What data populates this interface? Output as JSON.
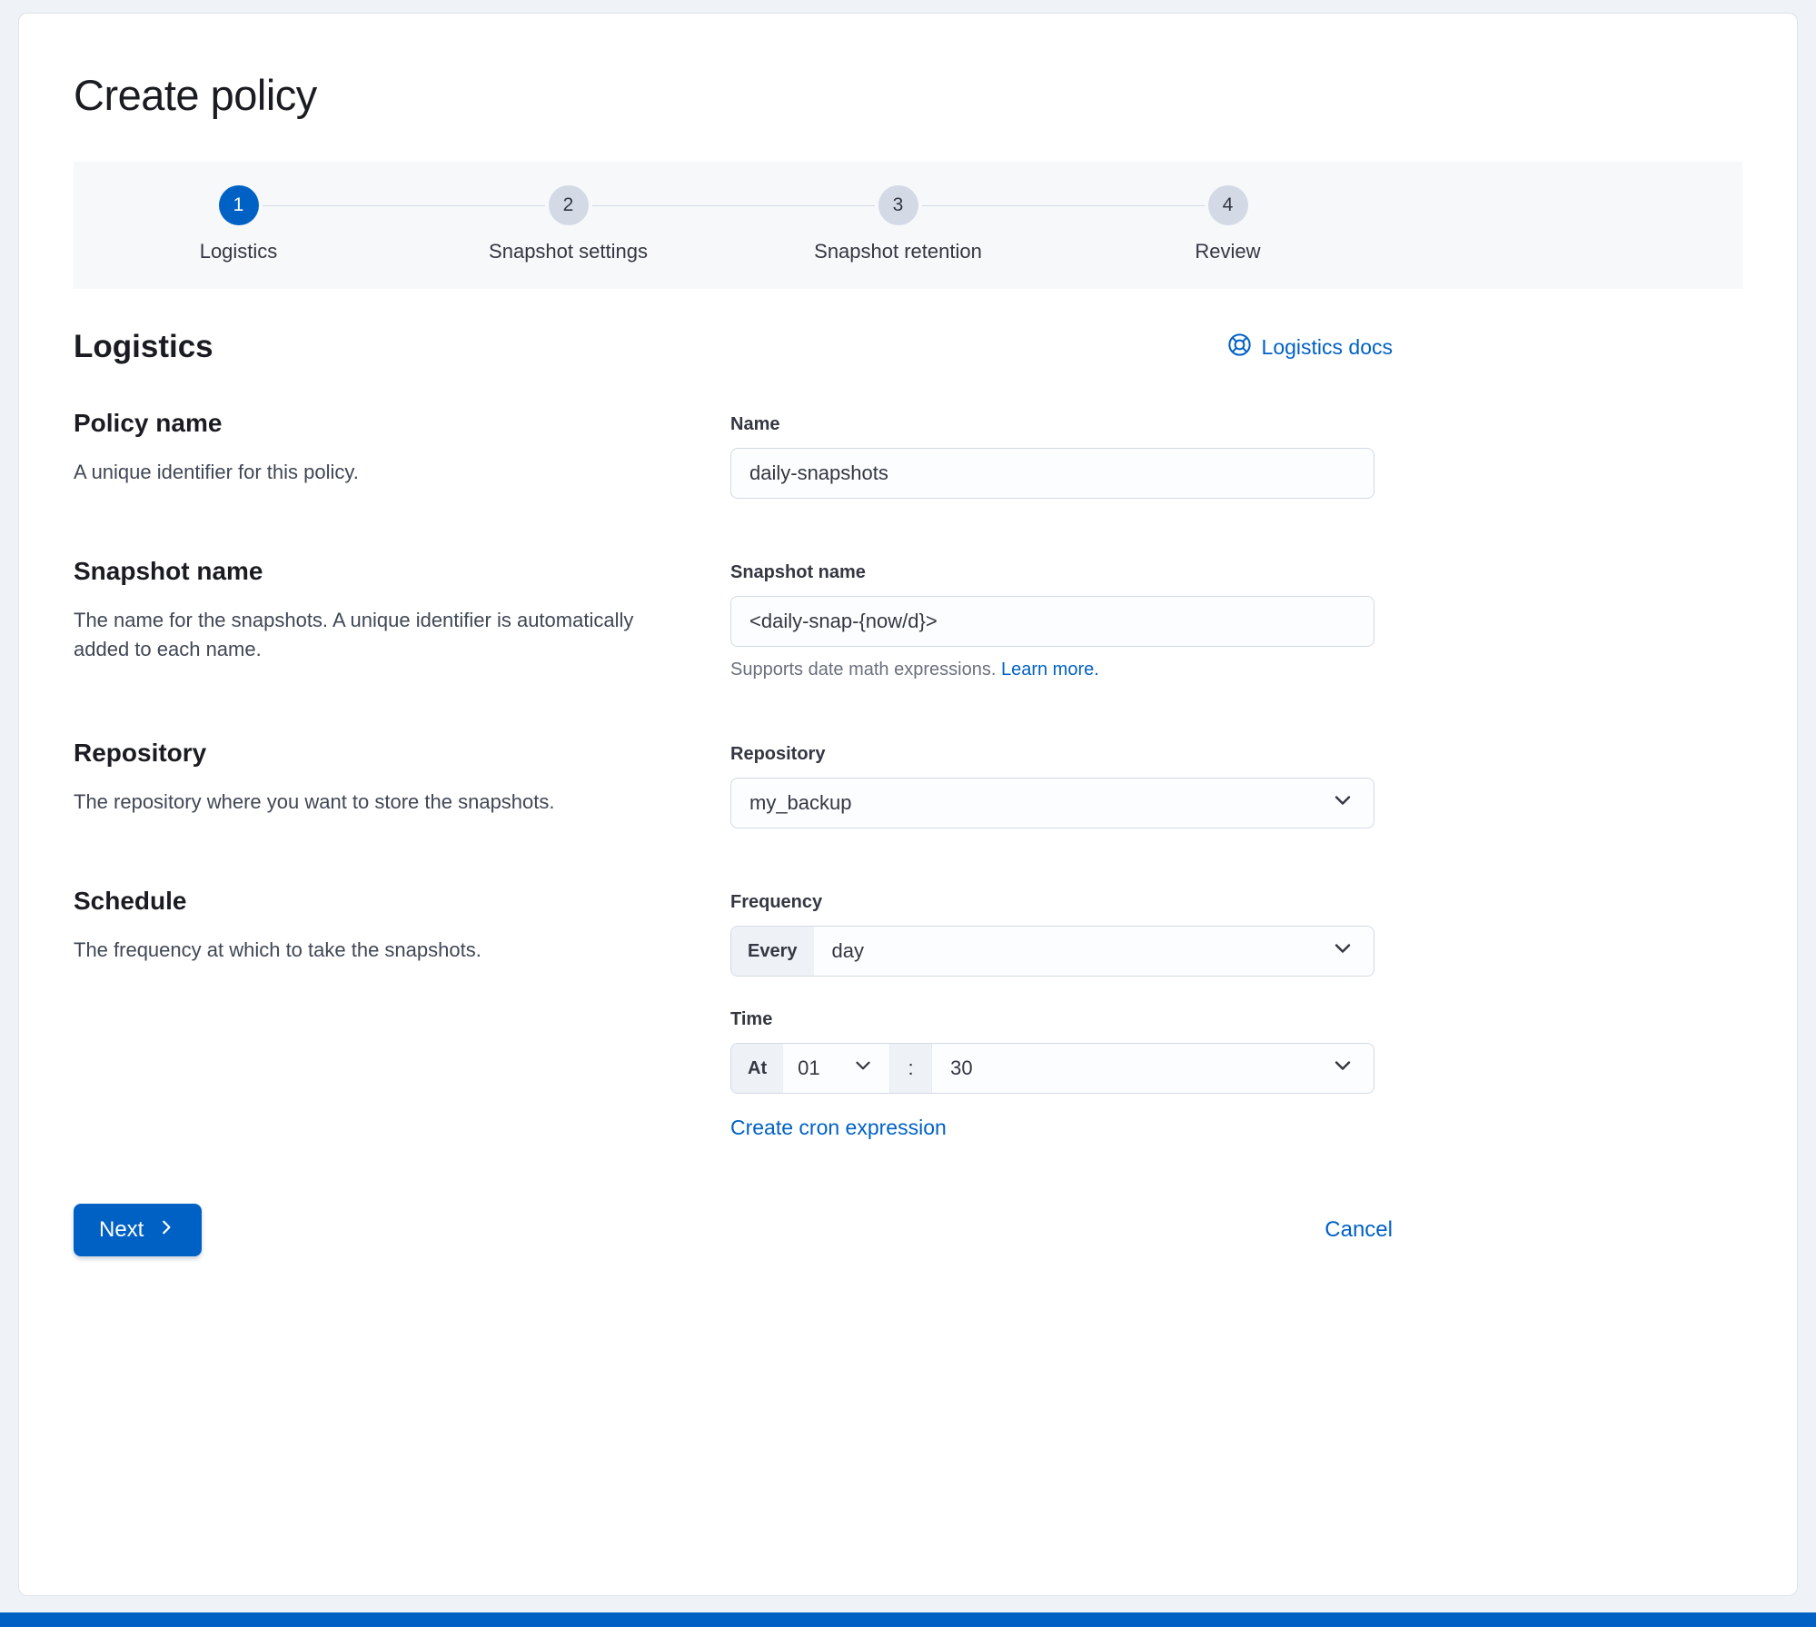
{
  "page": {
    "title": "Create policy"
  },
  "steps": [
    {
      "number": "1",
      "label": "Logistics",
      "state": "current"
    },
    {
      "number": "2",
      "label": "Snapshot settings",
      "state": "incomplete"
    },
    {
      "number": "3",
      "label": "Snapshot retention",
      "state": "incomplete"
    },
    {
      "number": "4",
      "label": "Review",
      "state": "incomplete"
    }
  ],
  "section": {
    "heading": "Logistics",
    "docs_link_label": "Logistics docs",
    "docs_icon": "life-ring-icon"
  },
  "form": {
    "policy_name": {
      "title": "Policy name",
      "description": "A unique identifier for this policy.",
      "label": "Name",
      "value": "daily-snapshots"
    },
    "snapshot_name": {
      "title": "Snapshot name",
      "description": "The name for the snapshots. A unique identifier is automatically added to each name.",
      "label": "Snapshot name",
      "value": "<daily-snap-{now/d}>",
      "help_text": "Supports date math expressions.",
      "help_link_label": "Learn more."
    },
    "repository": {
      "title": "Repository",
      "description": "The repository where you want to store the snapshots.",
      "label": "Repository",
      "value": "my_backup"
    },
    "schedule": {
      "title": "Schedule",
      "description": "The frequency at which to take the snapshots.",
      "frequency_label": "Frequency",
      "frequency_prepend": "Every",
      "frequency_value": "day",
      "time_label": "Time",
      "time_prepend": "At",
      "time_hour": "01",
      "time_separator": ":",
      "time_minute": "30",
      "cron_link_label": "Create cron expression"
    }
  },
  "footer": {
    "next_label": "Next",
    "cancel_label": "Cancel"
  },
  "colors": {
    "primary": "#0061c5",
    "link": "#0061c5",
    "step_incomplete_bg": "#d3dae6",
    "steps_bar_bg": "#f6f8fa",
    "input_border": "#d3dae6",
    "prepend_bg": "#eef2f7",
    "accent_bar": "#0061c5"
  }
}
